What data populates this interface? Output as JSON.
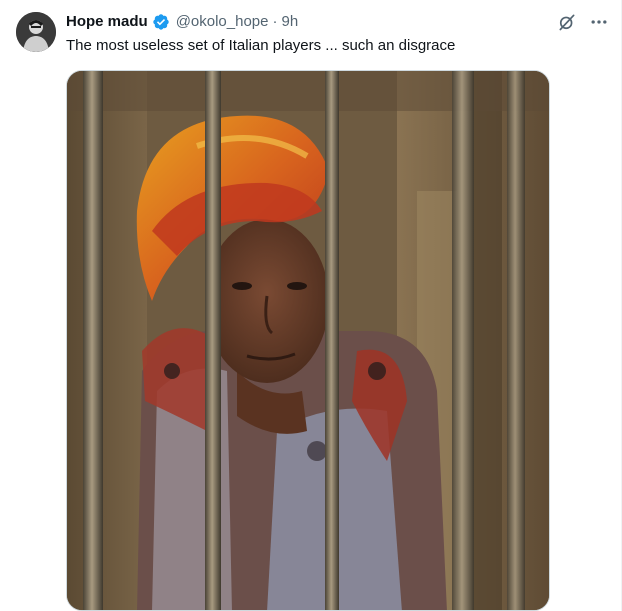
{
  "tweet": {
    "author": {
      "display_name": "Hope madu",
      "verified": true,
      "handle": "@okolo_hope",
      "separator": "·",
      "time": "9h"
    },
    "text": "The most useless set of Italian players ... such an disgrace",
    "media": {
      "alt": "Photo of a woman in an orange and red headscarf looking through metal bars"
    },
    "actions": {
      "grok_icon": "grok-icon",
      "more_icon": "more-options-icon"
    }
  },
  "colors": {
    "verified_blue": "#1d9bf0",
    "secondary_text": "#536471",
    "primary_text": "#0f1419"
  }
}
